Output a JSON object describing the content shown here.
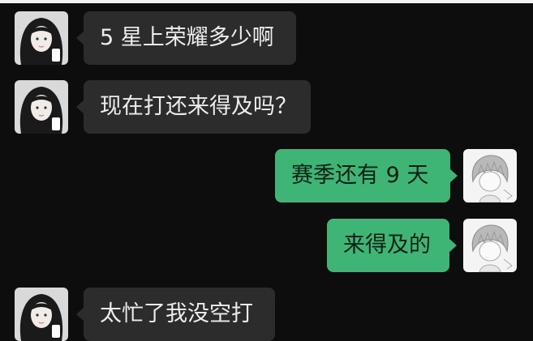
{
  "colors": {
    "background": "#0d0d0d",
    "incoming_bubble": "#2c2c2c",
    "outgoing_bubble": "#3eb574"
  },
  "messages": [
    {
      "sender": "other",
      "avatar": "girl-avatar-icon",
      "text": "5 星上荣耀多少啊"
    },
    {
      "sender": "other",
      "avatar": "girl-avatar-icon",
      "text": "现在打还来得及吗？"
    },
    {
      "sender": "self",
      "avatar": "boy-avatar-icon",
      "text": "赛季还有 9 天"
    },
    {
      "sender": "self",
      "avatar": "boy-avatar-icon",
      "text": "来得及的"
    },
    {
      "sender": "other",
      "avatar": "girl-avatar-icon",
      "text": "太忙了我没空打"
    }
  ]
}
